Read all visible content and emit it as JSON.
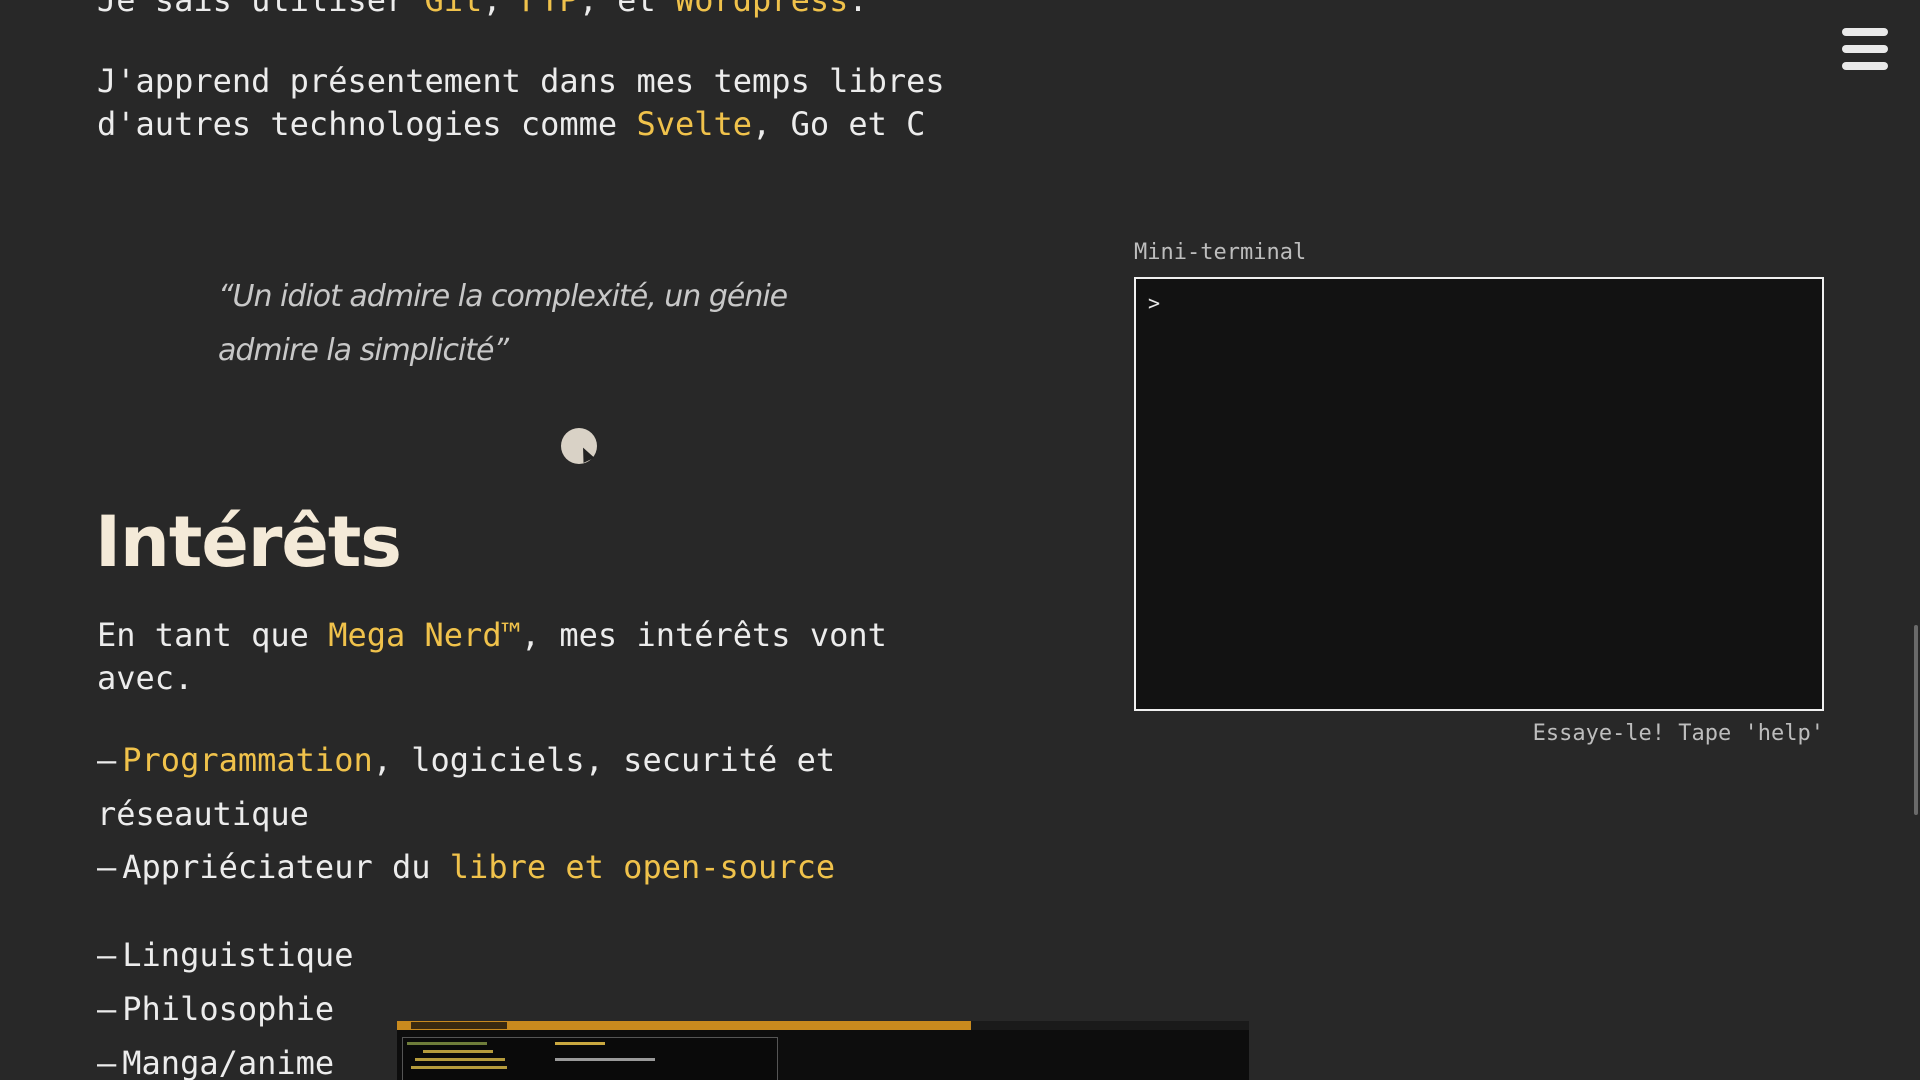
{
  "skills": {
    "prefix": "Je sais utiliser ",
    "tech1": "Git",
    "sep1": ", ",
    "tech2": "FTP",
    "sep2": ", et ",
    "tech3": "Wordpress",
    "suffix": "."
  },
  "learning": {
    "line1": "J'apprend présentement dans mes temps libres",
    "line2_prefix": "d'autres technologies comme ",
    "highlight": "Svelte",
    "line2_suffix": ", Go et C"
  },
  "quote": {
    "text": "“Un idiot admire la complexité, un génie admire la simplicité”"
  },
  "interests": {
    "heading": "Intérêts",
    "intro_prefix": "En tant que ",
    "intro_highlight": "Mega Nerd™",
    "intro_suffix": ", mes intérêts vont",
    "intro_line2": "avec.",
    "dash": "–",
    "items": [
      {
        "highlight": "Programmation",
        "text": ", logiciels, securité et"
      },
      {
        "text": "réseautique"
      },
      {
        "prefix": "Appriéciateur du ",
        "highlight": "libre et open-source"
      },
      {
        "text": "Linguistique"
      },
      {
        "text": "Philosophie"
      },
      {
        "text": "Manga/anime"
      }
    ]
  },
  "terminal": {
    "label": "Mini-terminal",
    "prompt": ">",
    "input_value": "",
    "hint": "Essaye-le! Tape 'help'"
  },
  "menu": {
    "icon": "hamburger-menu-icon"
  },
  "colors": {
    "background": "#282828",
    "accent": "#f0c24b",
    "text": "#ececec",
    "terminal_bg": "#121212"
  }
}
